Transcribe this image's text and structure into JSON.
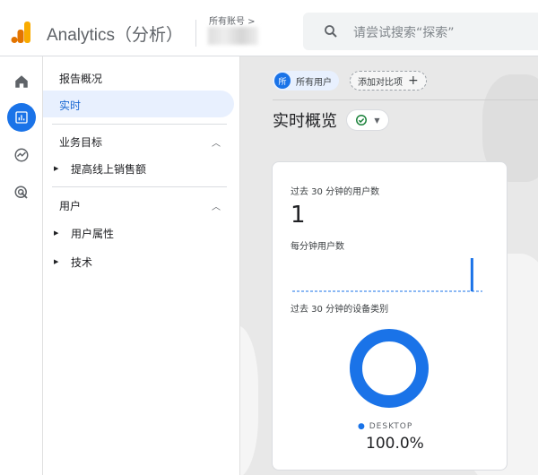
{
  "header": {
    "app_title": "Analytics（分析）",
    "account_label": "所有账号 >",
    "search_placeholder": "请尝试搜索“探索”"
  },
  "rail": {
    "items": [
      "home-icon",
      "reports-icon",
      "explore-icon",
      "advertising-icon"
    ],
    "active": 1,
    "accent": "#1a73e8"
  },
  "nav": {
    "overview": "报告概况",
    "realtime": "实时",
    "section1": "业务目标",
    "section1_item": "提高线上销售额",
    "section2": "用户",
    "section2_items": [
      "用户属性",
      "技术"
    ]
  },
  "main": {
    "chip_badge": "所",
    "chip_all": "所有用户",
    "chip_add": "添加对比项",
    "chip_add_icon": "+",
    "page_title": "实时概览"
  },
  "card": {
    "users_label": "过去 30 分钟的用户数",
    "users_value": "1",
    "per_minute_label": "每分钟用户数",
    "device_label": "过去 30 分钟的设备类别",
    "legend": "DESKTOP",
    "percent": "100.0%"
  },
  "chart_data": [
    {
      "type": "bar",
      "title": "每分钟用户数",
      "values": [
        0,
        0,
        0,
        0,
        0,
        0,
        0,
        0,
        0,
        0,
        0,
        0,
        0,
        0,
        0,
        0,
        0,
        0,
        0,
        0,
        0,
        0,
        0,
        0,
        0,
        0,
        0,
        0,
        1,
        0
      ]
    },
    {
      "type": "pie",
      "title": "过去 30 分钟的设备类别",
      "categories": [
        "DESKTOP"
      ],
      "values": [
        100.0
      ],
      "colors": [
        "#1a73e8"
      ]
    }
  ]
}
